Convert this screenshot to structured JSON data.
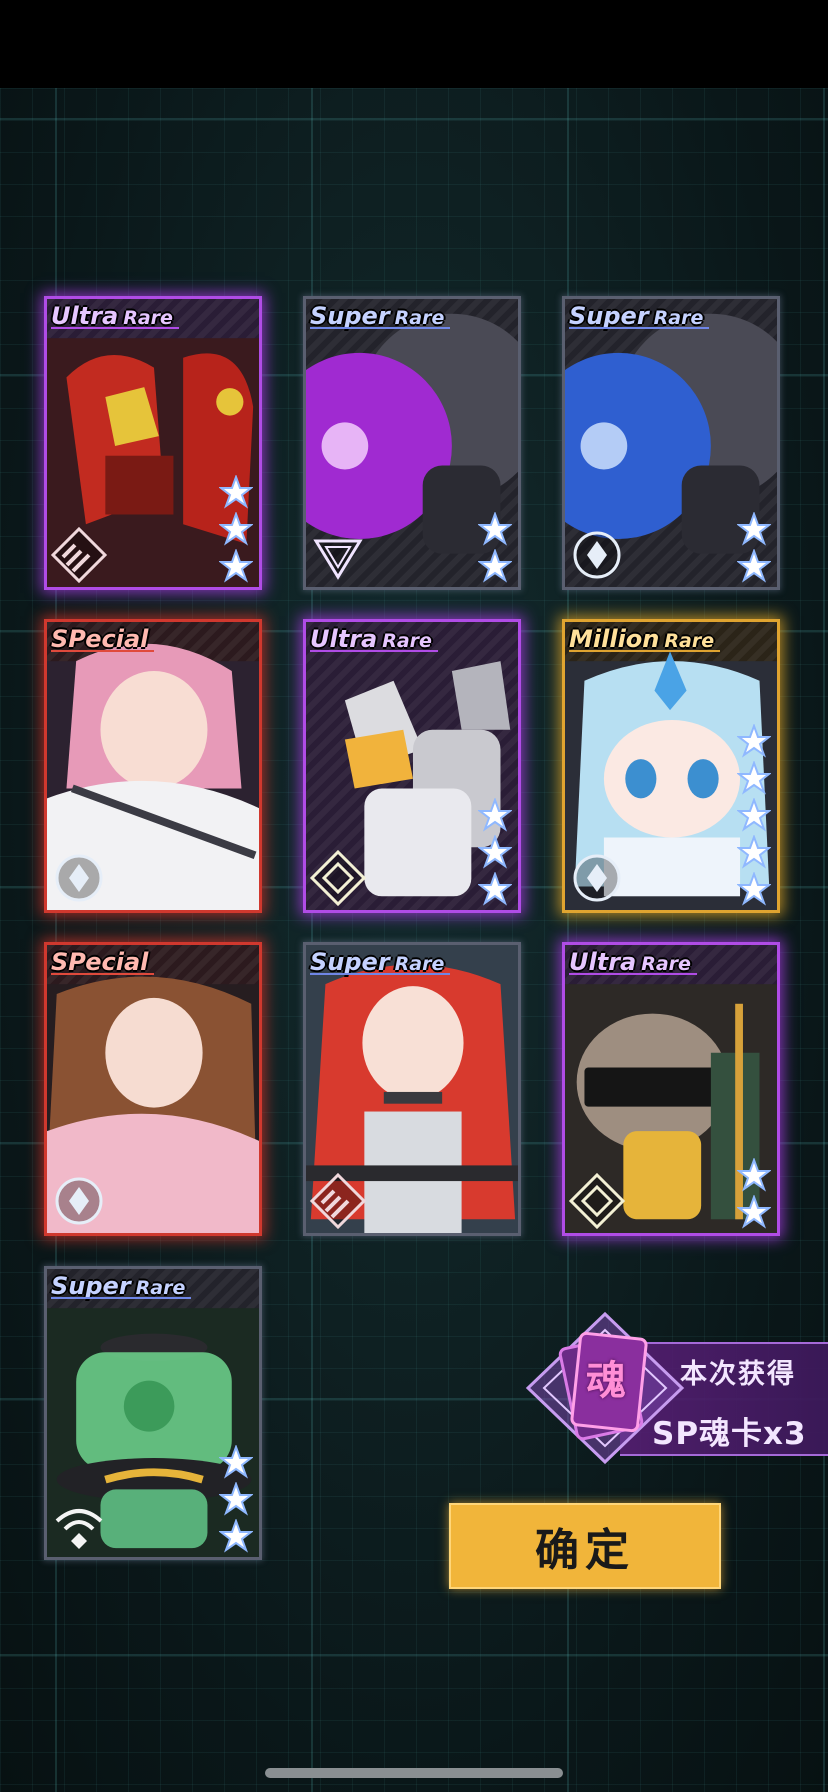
{
  "cards": [
    {
      "rarity_1": "Ultra",
      "rarity_2": "Rare",
      "tier": "ur",
      "stars": 3,
      "badge": "rank-stripes-icon",
      "art": "red-mech"
    },
    {
      "rarity_1": "Super",
      "rarity_2": "Rare",
      "tier": "sr",
      "stars": 2,
      "badge": "rank-triangle-icon",
      "art": "purple-bomb"
    },
    {
      "rarity_1": "Super",
      "rarity_2": "Rare",
      "tier": "sr",
      "stars": 2,
      "badge": "rank-circle-icon",
      "art": "blue-bomb"
    },
    {
      "rarity_1": "SPecial",
      "rarity_2": "",
      "tier": "sp",
      "stars": 0,
      "badge": "rank-circle-icon",
      "art": "pink-hair-girl"
    },
    {
      "rarity_1": "Ultra",
      "rarity_2": "Rare",
      "tier": "ur",
      "stars": 3,
      "badge": "rank-diamond-icon",
      "art": "white-mech"
    },
    {
      "rarity_1": "Million",
      "rarity_2": "Rare",
      "tier": "mr",
      "stars": 5,
      "badge": "rank-circle-icon",
      "art": "blue-hair-chibi"
    },
    {
      "rarity_1": "SPecial",
      "rarity_2": "",
      "tier": "sp",
      "stars": 0,
      "badge": "rank-circle-icon",
      "art": "brown-hair-girl"
    },
    {
      "rarity_1": "Super",
      "rarity_2": "Rare",
      "tier": "sr",
      "stars": 0,
      "badge": "rank-stripes-icon",
      "art": "red-twin-tails-girl"
    },
    {
      "rarity_1": "Ultra",
      "rarity_2": "Rare",
      "tier": "ur",
      "stars": 2,
      "badge": "rank-diamond-icon",
      "art": "visor-chibi"
    },
    {
      "rarity_1": "Super",
      "rarity_2": "Rare",
      "tier": "sr",
      "stars": 3,
      "badge": "rank-wifi-icon",
      "art": "green-skull-jar"
    }
  ],
  "reward": {
    "emblem_char": "魂",
    "line1": "本次获得",
    "line2": "SP魂卡x3"
  },
  "confirm_label": "确定",
  "colors": {
    "ultra_rare": "#b04ce6",
    "super_rare": "#5a5f70",
    "special": "#d0382e",
    "million_rare": "#e0a430",
    "confirm_button": "#f1b53a"
  }
}
